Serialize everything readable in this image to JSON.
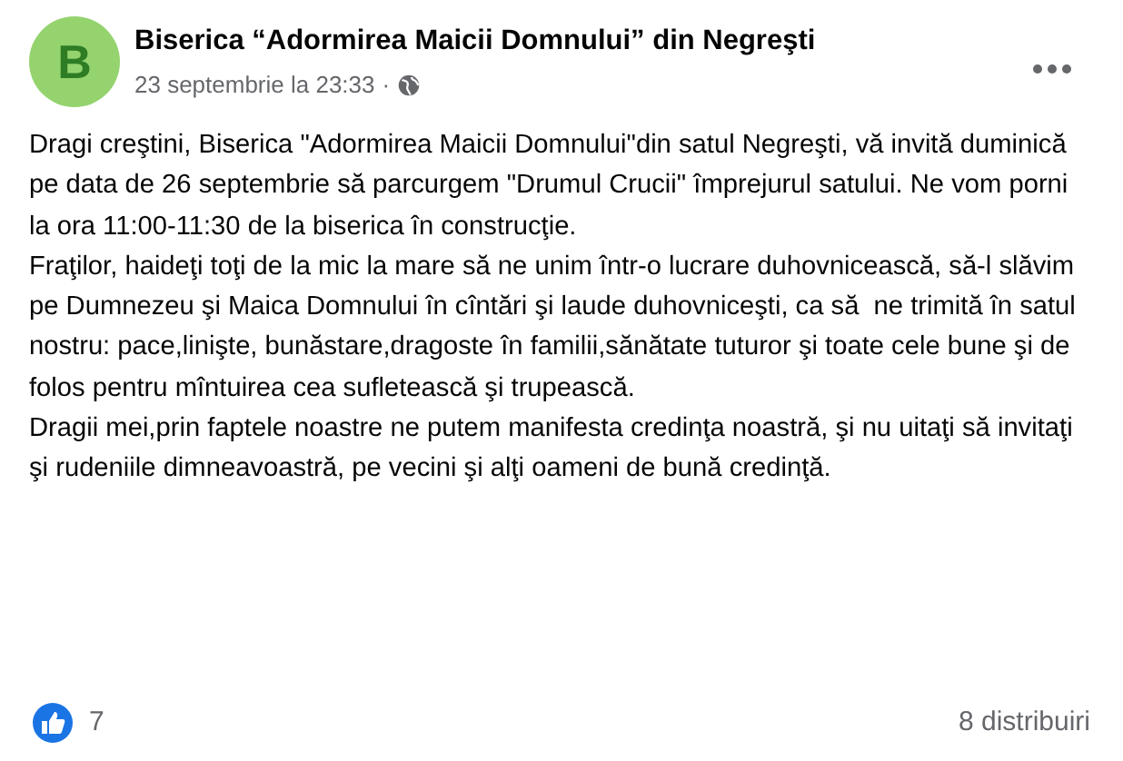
{
  "post": {
    "avatar_letter": "B",
    "author": "Biserica “Adormirea Maicii Domnului” din Negreşti",
    "time": "23 septembrie la 23:33",
    "separator": "·",
    "paragraphs": [
      "Dragi creştini, Biserica \"Adormirea Maicii Domnului\"din satul Negreşti, vă invită duminică pe data de 26 septembrie să parcurgem \"Drumul Crucii\" împrejurul satului. Ne vom porni la ora 11:00-11:30 de la biserica în construcţie.",
      "Fraţilor, haideţi toţi de la mic la mare să ne unim într-o lucrare duhovnicească, să-l slăvim pe Dumnezeu şi Maica Domnului în cîntări şi laude duhovniceşti, ca să  ne trimită în satul nostru: pace,linişte, bunăstare,dragoste în familii,sănătate tuturor şi toate cele bune şi de folos pentru mîntuirea cea sufletească şi trupească.",
      "Dragii mei,prin faptele noastre ne putem manifesta credinţa noastră, şi nu uitaţi să invitaţi şi rudeniile dimneavoastră, pe vecini şi alţi oameni de bună credinţă."
    ],
    "reactions": "7",
    "shares": "8 distribuiri"
  }
}
